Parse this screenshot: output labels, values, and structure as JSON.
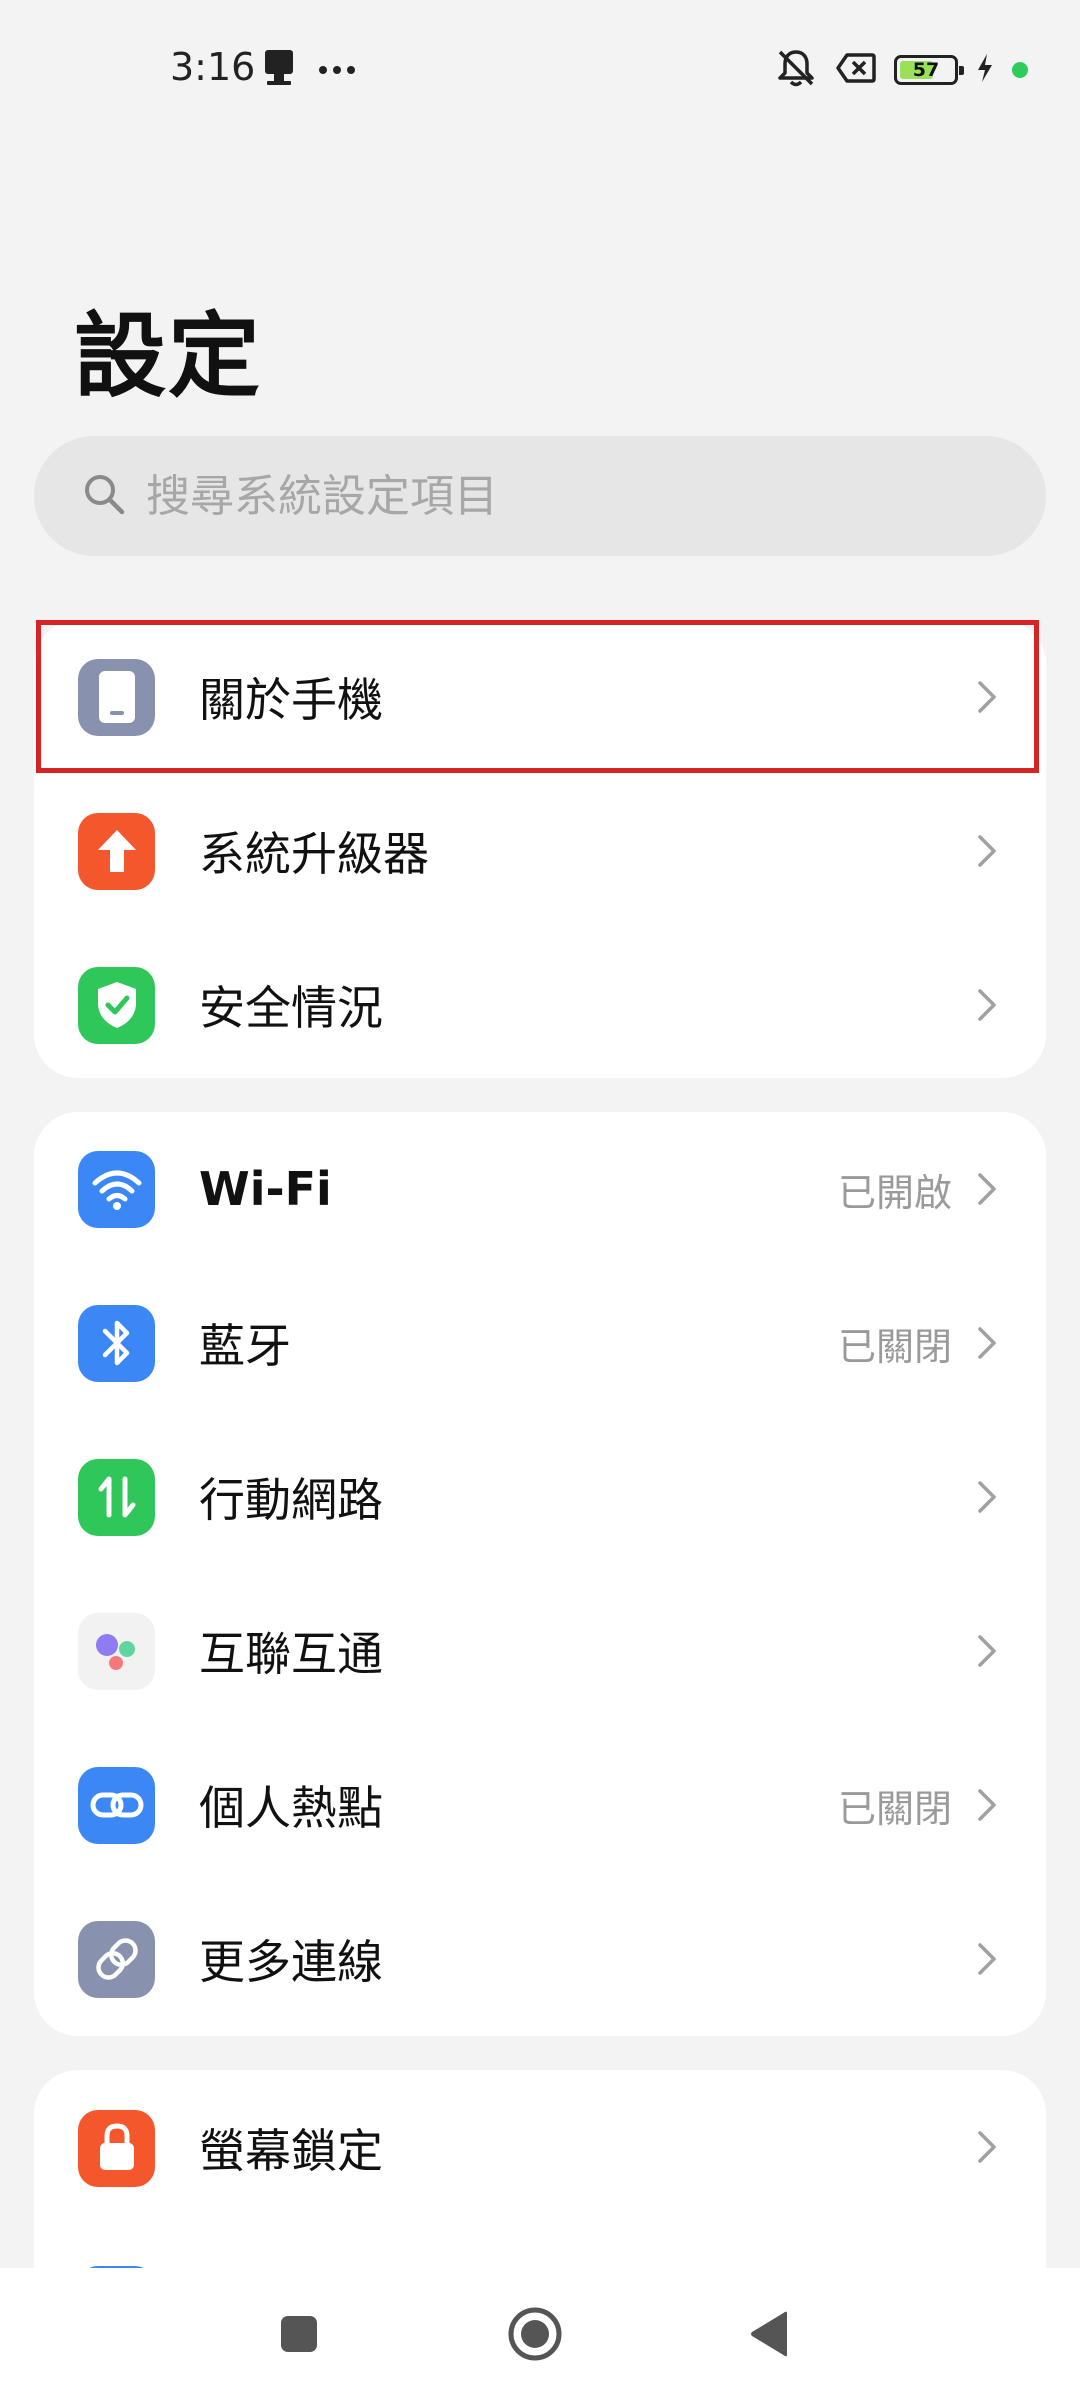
{
  "status_bar": {
    "time": "3:16",
    "battery_level": "57",
    "icons": [
      "sim-card-icon",
      "more-dots-icon",
      "silent-bell-icon",
      "no-sim-icon",
      "battery-icon",
      "charging-bolt-icon",
      "green-dot-indicator"
    ]
  },
  "page": {
    "title": "設定"
  },
  "search": {
    "placeholder": "搜尋系統設定項目"
  },
  "groups": [
    {
      "items": [
        {
          "label": "關於手機",
          "icon": "phone-icon",
          "color": "#8891ae",
          "value": ""
        },
        {
          "label": "系統升級器",
          "icon": "upload-arrow-icon",
          "color": "#f4572b",
          "value": ""
        },
        {
          "label": "安全情況",
          "icon": "shield-check-icon",
          "color": "#2fc65a",
          "value": ""
        }
      ]
    },
    {
      "items": [
        {
          "label": "Wi-Fi",
          "icon": "wifi-icon",
          "color": "#3b87f6",
          "value": "已開啟"
        },
        {
          "label": "藍牙",
          "icon": "bluetooth-icon",
          "color": "#3b87f6",
          "value": "已關閉"
        },
        {
          "label": "行動網路",
          "icon": "mobile-data-icon",
          "color": "#2fc65a",
          "value": ""
        },
        {
          "label": "互聯互通",
          "icon": "connect-dots-icon",
          "color": "#f2f2f2",
          "value": ""
        },
        {
          "label": "個人熱點",
          "icon": "hotspot-link-icon",
          "color": "#3b87f6",
          "value": "已關閉"
        },
        {
          "label": "更多連線",
          "icon": "link-icon",
          "color": "#8891ae",
          "value": ""
        }
      ]
    },
    {
      "items": [
        {
          "label": "螢幕鎖定",
          "icon": "lock-icon",
          "color": "#f4572b",
          "value": ""
        }
      ]
    }
  ],
  "highlight_color": "#d62323"
}
